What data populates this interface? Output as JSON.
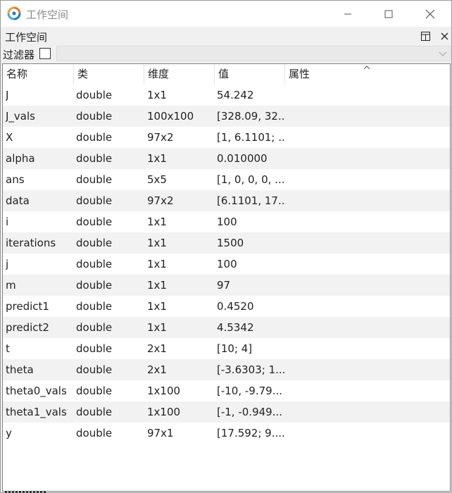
{
  "window": {
    "title": "工作空间"
  },
  "panel": {
    "title": "工作空间"
  },
  "filter": {
    "label": "过滤器",
    "checked": false,
    "value": ""
  },
  "columns": [
    "名称",
    "类",
    "维度",
    "值",
    "属性"
  ],
  "rows": [
    {
      "name": "J",
      "class": "double",
      "size": "1x1",
      "value": "54.242",
      "attr": ""
    },
    {
      "name": "J_vals",
      "class": "double",
      "size": "100x100",
      "value": "[328.09, 32...",
      "attr": ""
    },
    {
      "name": "X",
      "class": "double",
      "size": "97x2",
      "value": "[1, 6.1101; ...",
      "attr": ""
    },
    {
      "name": "alpha",
      "class": "double",
      "size": "1x1",
      "value": "0.010000",
      "attr": ""
    },
    {
      "name": "ans",
      "class": "double",
      "size": "5x5",
      "value": "[1, 0, 0, 0, ...",
      "attr": ""
    },
    {
      "name": "data",
      "class": "double",
      "size": "97x2",
      "value": "[6.1101, 17....",
      "attr": ""
    },
    {
      "name": "i",
      "class": "double",
      "size": "1x1",
      "value": "100",
      "attr": ""
    },
    {
      "name": "iterations",
      "class": "double",
      "size": "1x1",
      "value": "1500",
      "attr": ""
    },
    {
      "name": "j",
      "class": "double",
      "size": "1x1",
      "value": "100",
      "attr": ""
    },
    {
      "name": "m",
      "class": "double",
      "size": "1x1",
      "value": "97",
      "attr": ""
    },
    {
      "name": "predict1",
      "class": "double",
      "size": "1x1",
      "value": "0.4520",
      "attr": ""
    },
    {
      "name": "predict2",
      "class": "double",
      "size": "1x1",
      "value": "4.5342",
      "attr": ""
    },
    {
      "name": "t",
      "class": "double",
      "size": "2x1",
      "value": "[10; 4]",
      "attr": ""
    },
    {
      "name": "theta",
      "class": "double",
      "size": "2x1",
      "value": "[-3.6303; 1....",
      "attr": ""
    },
    {
      "name": "theta0_vals",
      "class": "double",
      "size": "1x100",
      "value": "[-10, -9.79...",
      "attr": ""
    },
    {
      "name": "theta1_vals",
      "class": "double",
      "size": "1x100",
      "value": "[-1, -0.949...",
      "attr": ""
    },
    {
      "name": "y",
      "class": "double",
      "size": "97x1",
      "value": "[17.592; 9....",
      "attr": ""
    }
  ],
  "icons": {
    "app": "octave-logo-icon",
    "minimize": "minimize-icon",
    "maximize": "maximize-icon",
    "close": "close-icon",
    "undock": "undock-icon",
    "panel_close": "close-icon",
    "sort": "sort-ascending-icon",
    "combo": "chevron-down-icon"
  }
}
